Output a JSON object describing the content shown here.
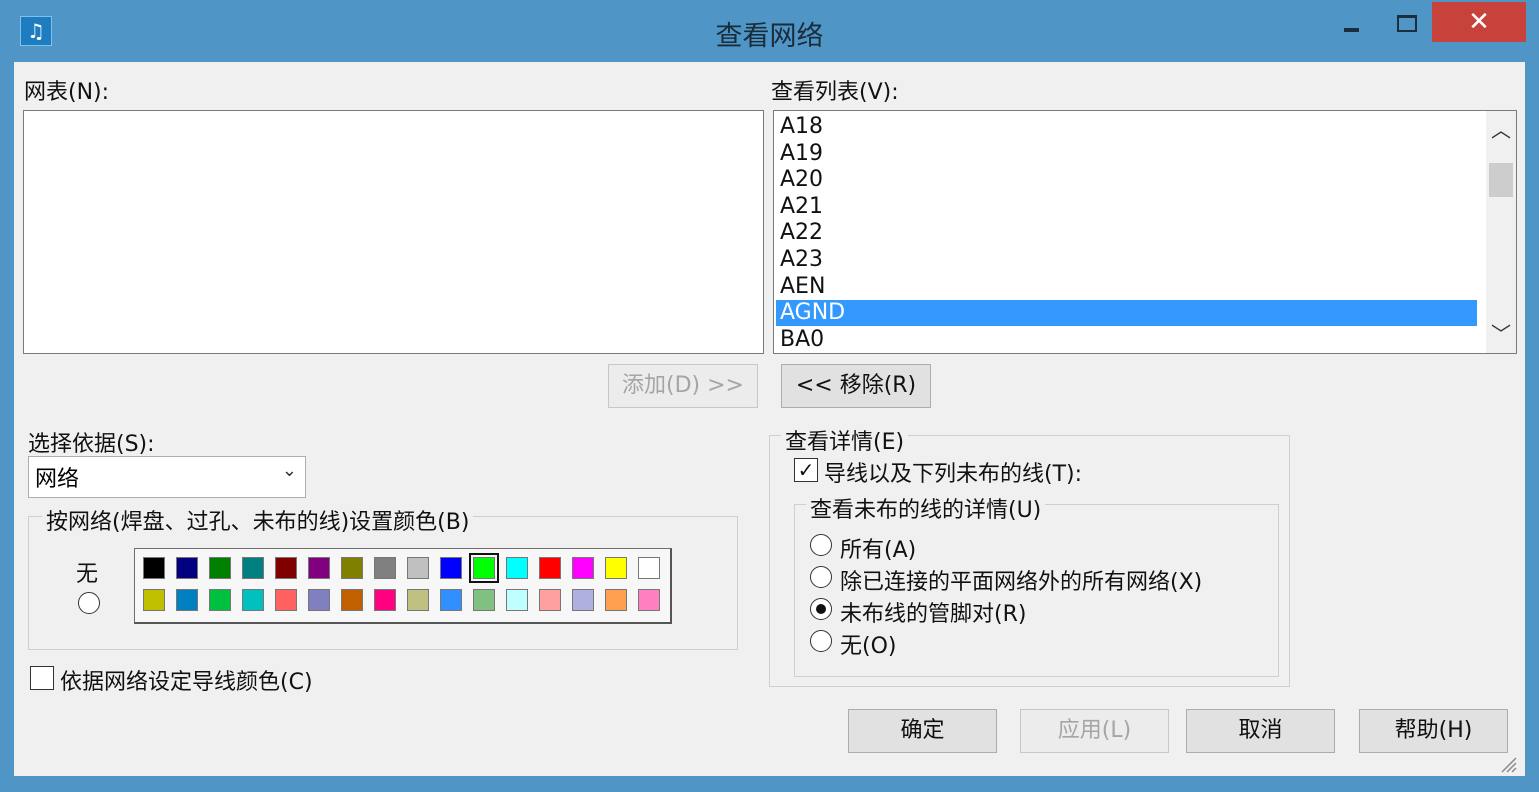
{
  "window": {
    "title": "查看网络",
    "close_glyph": "✕"
  },
  "left": {
    "netlist_label": "网表(N):",
    "add_button": "添加(D) >>",
    "basis_label": "选择依据(S):",
    "basis_value": "网络",
    "color_group_title": "按网络(焊盘、过孔、未布的线)设置颜色(B)",
    "none_label": "无",
    "colors_row1": [
      "#000000",
      "#000080",
      "#008000",
      "#008080",
      "#800000",
      "#800080",
      "#808000",
      "#808080",
      "#c0c0c0",
      "#0000ff",
      "#00ff00",
      "#00ffff",
      "#ff0000",
      "#ff00ff",
      "#ffff00",
      "#ffffff"
    ],
    "colors_row2": [
      "#c0c000",
      "#0080c0",
      "#00c040",
      "#00c0c0",
      "#ff6060",
      "#8080c0",
      "#c06000",
      "#ff0080",
      "#c0c080",
      "#3090ff",
      "#80c080",
      "#c0ffff",
      "#ffa0a0",
      "#b0b0e0",
      "#ffa050",
      "#ff80c0"
    ],
    "selected_color": "#00ff00",
    "trace_color_checkbox": "依据网络设定导线颜色(C)",
    "trace_color_checked": false
  },
  "right": {
    "viewlist_label": "查看列表(V):",
    "items": [
      "A18",
      "A19",
      "A20",
      "A21",
      "A22",
      "A23",
      "AEN",
      "AGND",
      "BA0"
    ],
    "selected_item": "AGND",
    "remove_button": "<< 移除(R)",
    "details_title": "查看详情(E)",
    "traces_checkbox": "导线以及下列未布的线(T):",
    "traces_checked": true,
    "unrouted_title": "查看未布的线的详情(U)",
    "radios": [
      {
        "label": "所有(A)",
        "checked": false
      },
      {
        "label": "除已连接的平面网络外的所有网络(X)",
        "checked": false
      },
      {
        "label": "未布线的管脚对(R)",
        "checked": true
      },
      {
        "label": "无(O)",
        "checked": false
      }
    ]
  },
  "footer": {
    "ok": "确定",
    "apply": "应用(L)",
    "cancel": "取消",
    "help": "帮助(H)"
  }
}
